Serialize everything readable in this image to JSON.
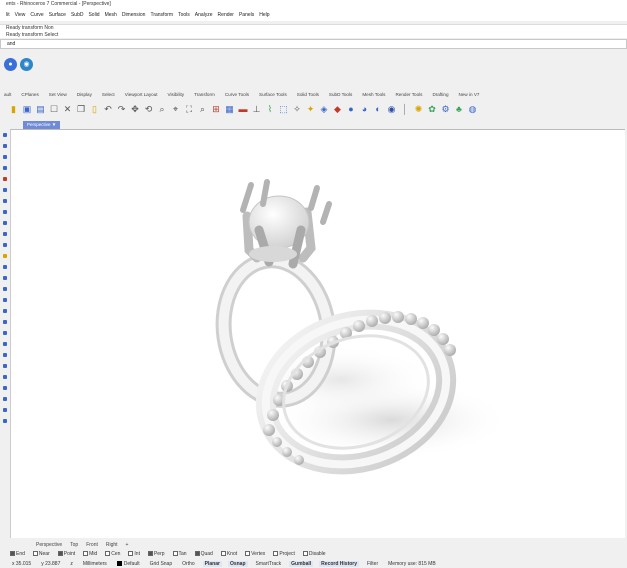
{
  "titlebar": {
    "title": "ents - Rhinoceros 7 Commercial - [Perspective]"
  },
  "menubar": {
    "items": [
      "lit",
      "View",
      "Curve",
      "Surface",
      "SubD",
      "Solid",
      "Mesh",
      "Dimension",
      "Transform",
      "Tools",
      "Analyze",
      "Render",
      "Panels",
      "Help"
    ]
  },
  "command_history": {
    "line1": "Ready transform Non",
    "line2": "Ready transform Select"
  },
  "command_line": {
    "value": "and"
  },
  "ribbon_tabs": {
    "items": [
      "ault",
      "CPlanes",
      "Set View",
      "Display",
      "Select",
      "Viewport Layout",
      "Visibility",
      "Transform",
      "Curve Tools",
      "Surface Tools",
      "Solid Tools",
      "SubD Tools",
      "Mesh Tools",
      "Render Tools",
      "Drafting",
      "New in V7"
    ]
  },
  "viewport": {
    "tab_label": "Perspective",
    "tab_arrow": "▼"
  },
  "viewport_tabs": {
    "items": [
      "Perspective",
      "Top",
      "Front",
      "Right",
      "+"
    ]
  },
  "osnaps": {
    "items": [
      {
        "label": "End",
        "checked": true
      },
      {
        "label": "Near",
        "checked": false
      },
      {
        "label": "Point",
        "checked": true
      },
      {
        "label": "Mid",
        "checked": false
      },
      {
        "label": "Cen",
        "checked": false
      },
      {
        "label": "Int",
        "checked": false
      },
      {
        "label": "Perp",
        "checked": true
      },
      {
        "label": "Tan",
        "checked": false
      },
      {
        "label": "Quad",
        "checked": true
      },
      {
        "label": "Knot",
        "checked": false
      },
      {
        "label": "Vertex",
        "checked": false
      },
      {
        "label": "Project",
        "checked": false
      },
      {
        "label": "Disable",
        "checked": false
      }
    ]
  },
  "statusbar": {
    "x": "x 35.015",
    "y": "y 23.887",
    "z": "z",
    "units": "Millimeters",
    "layer": "Default",
    "grid_snap": "Grid Snap",
    "ortho": "Ortho",
    "planar": "Planar",
    "osnap": "Osnap",
    "smarttrack": "SmartTrack",
    "gumball": "Gumball",
    "record_history": "Record History",
    "filter": "Filter",
    "memory": "Memory use: 815 MB"
  },
  "colors": {
    "viewport_tab": "#6f8bd8",
    "active_pane": "#dde6f5"
  }
}
